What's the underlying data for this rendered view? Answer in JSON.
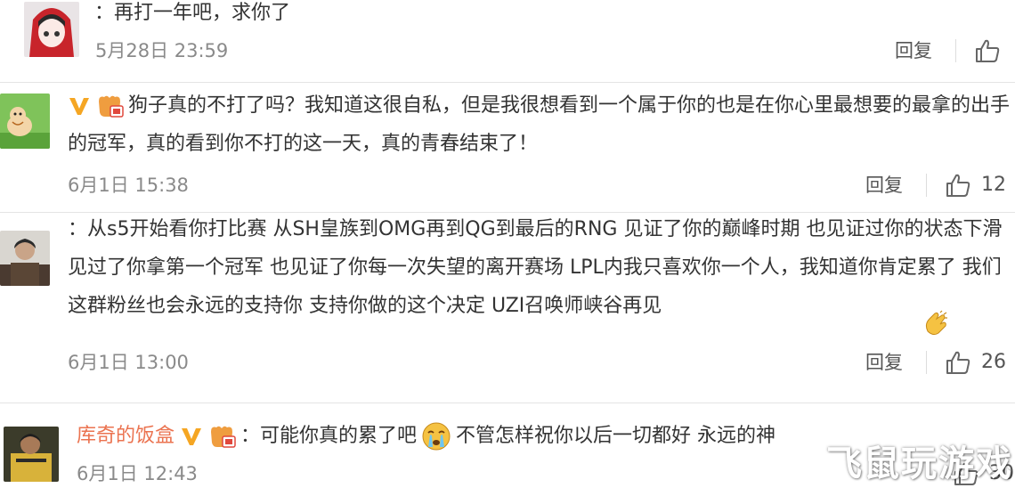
{
  "comments": [
    {
      "text": "：再打一年吧，求你了",
      "time": "5月28日 23:59",
      "reply_label": "回复",
      "likes": ""
    },
    {
      "text": "狗子真的不打了吗？我知道这很自私，但是我很想看到一个属于你的也是在你心里最想要的最拿的出手的冠军，真的看到你不打的这一天，真的青春结束了！",
      "time": "6月1日 15:38",
      "reply_label": "回复",
      "likes": "12"
    },
    {
      "text": "：从s5开始看你打比赛 从SH皇族到OMG再到QG到最后的RNG 见证了你的巅峰时期 也见证过你的状态下滑 见过了你拿第一个冠军 也见证了你每一次失望的离开赛场 LPL内我只喜欢你一个人，我知道你肯定累了 我们这群粉丝也会永远的支持你 支持你做的这个决定 UZI召唤师峡谷再见",
      "time": "6月1日 13:00",
      "reply_label": "回复",
      "likes": "26"
    },
    {
      "username": "库奇的饭盒",
      "text_a": "：可能你真的累了吧",
      "text_b": "不管怎样祝你以后一切都好 永远的神",
      "time": "6月1日 12:43",
      "likes": "30"
    }
  ],
  "watermark": "飞鼠玩游戏",
  "icons": {
    "like": "thumbs-up-icon",
    "vip": "v-badge-icon",
    "fan": "fan-badge-icon"
  },
  "colors": {
    "username": "#eb7350",
    "vip": "#f5a623",
    "time": "#8a8a8a"
  }
}
